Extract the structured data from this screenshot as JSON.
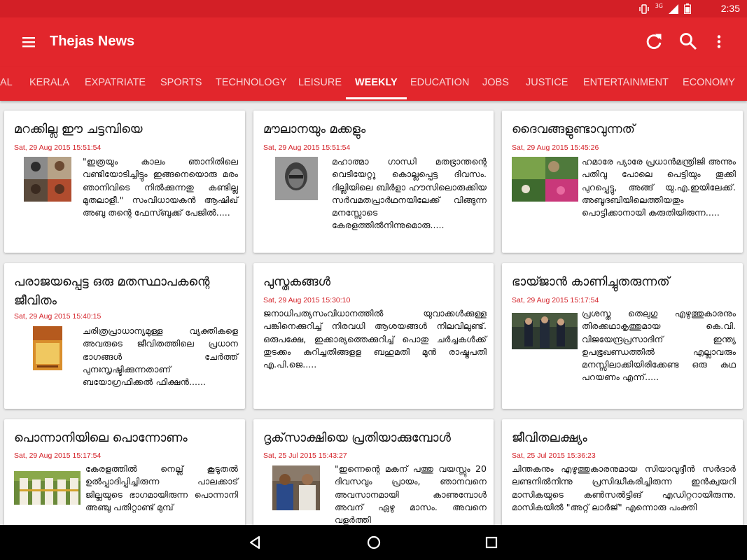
{
  "status_bar": {
    "network": "3G",
    "time": "2:35"
  },
  "app_bar": {
    "title": "Thejas News"
  },
  "tabs": [
    {
      "label": "AL"
    },
    {
      "label": "KERALA"
    },
    {
      "label": "EXPATRIATE"
    },
    {
      "label": "SPORTS"
    },
    {
      "label": "TECHNOLOGY"
    },
    {
      "label": "LEISURE"
    },
    {
      "label": "WEEKLY",
      "active": true
    },
    {
      "label": "EDUCATION"
    },
    {
      "label": "JOBS"
    },
    {
      "label": "JUSTICE"
    },
    {
      "label": "ENTERTAINMENT"
    },
    {
      "label": "ECONOMY"
    }
  ],
  "cards": [
    {
      "title": "മറക്കില്ല ഈ ചട്ടമ്പിയെ",
      "date": "Sat, 29 Aug 2015 15:51:54",
      "excerpt": "\"ഇത്രയും കാലം ഞാനിതിലെ വണ്ടിയോടിച്ചിട്ടും ഇങ്ങനെയൊരു മരം ഞാനിവിടെ നില്‍ക്കുന്നതു കണ്ടില്ല മുതലാളീ.\" സംവിധായകന്‍ ആഷിഖ് അബു തന്റെ ഫേസ്ബുക്ക് പേജില്‍....."
    },
    {
      "title": "മൗലാനയും മക്കളും",
      "date": "Sat, 29 Aug 2015 15:51:54",
      "excerpt": "മഹാത്മാ ഗാന്ധി മതഭ്രാന്തന്റെ വെടിയേറ്റു കൊല്ലപ്പെട്ട ദിവസം. ദില്ലിയിലെ ബിര്‍ളാ ഹൗസിലൊരുക്കിയ സര്‍വമതപ്രാര്‍ഥനയിലേക്ക് വിങ്ങുന്ന മനസ്സോടെ കേരളത്തില്‍നിന്നുമൊരു....."
    },
    {
      "title": "ദൈവങ്ങളുണ്ടാവുന്നത്",
      "date": "Sat, 29 Aug 2015 15:45:26",
      "excerpt": "ഹമാരേ പ്യാരേ പ്രധാന്‍മന്ത്രിജി അന്നും പതിവു പോലെ പെട്ടിയും തൂക്കി പുറപ്പെട്ടു, അങ്ങ് യു.എ.ഇയിലേക്ക്. അബൂദബിയിലെത്തിയതും പൊട്ടിക്കാനായി കരുതിയിരുന്ന....."
    },
    {
      "title": "പരാജയപ്പെട്ട ഒരു മതസ്ഥാപകന്റെ ജീവിതം",
      "date": "Sat, 29 Aug 2015 15:40:15",
      "excerpt": "ചരിത്രപ്രാധാന്യമുള്ള വ്യക്തികളെ അവരുടെ ജീവിതത്തിലെ പ്രധാന ഭാഗങ്ങള്‍ ചേര്‍ത്ത് പുനഃസൃഷ്ടിക്കുന്നതാണ് ബയോഗ്രഫിക്കല്‍ ഫിക്ഷന്‍......"
    },
    {
      "title": "പുസ്തകങ്ങള്‍",
      "date": "Sat, 29 Aug 2015 15:30:10",
      "excerpt": "ജനാധിപത്യസംവിധാനത്തില്‍ യുവാക്കള്‍ക്കുള്ള പങ്കിനെക്കുറിച്ച് നിരവധി ആശയങ്ങള്‍ നിലവിലുണ്ട്. ഒരുപക്ഷേ, ഇക്കാര്യത്തെക്കുറിച്ച് പൊതു ചര്‍ച്ചകള്‍ക്ക് തുടക്കം കുറിച്ചതിങ്ങളള ബഹുമതി മുന്‍ രാഷ്ട്രപതി എ.പി.ജെ....."
    },
    {
      "title": "ഭായ്ജാന്‍ കാണിച്ചുതരുന്നത്",
      "date": "Sat, 29 Aug 2015 15:17:54",
      "excerpt": "പ്രശസ്ത തെലുഗു എഴുത്തുകാരനും തിരക്കഥാകൃത്തുമായ കെ.വി. വിജയേന്ദ്രപ്രസാദിന് ഇന്ത്യ ഉപഭൂഖണ്ഡത്തില്‍ എല്ലാവരും മനസ്സിലാക്കിയിരിക്കേണ്ട ഒരു കഥ പറയണം എന്ന്....."
    },
    {
      "title": "പൊന്നാനിയിലെ പൊന്നോണം",
      "date": "Sat, 29 Aug 2015 15:17:54",
      "excerpt": "കേരളത്തില്‍ നെല്ല് കൂടുതല്‍ ഉല്‍പ്പാദിപ്പിച്ചിരുന്ന പാലക്കാട് ജില്ലയുടെ ഭാഗമായിരുന്ന പൊന്നാനി അഞ്ചു പതിറ്റാണ്ട് മുമ്പ്"
    },
    {
      "title": "ദൃക്‌സാക്ഷിയെ പ്രതിയാക്കുമ്പോള്‍",
      "date": "Sat, 25 Jul 2015 15:43:27",
      "excerpt": "\"ഇന്നെന്റെ മകന് പത്തു വയസ്സും 20 ദിവസവും പ്രായം, ഞാനവനെ അവസാനമായി കാണുമ്പോള്‍ അവന് ഏഴു മാസം. അവനെ വളര്‍ത്തി"
    },
    {
      "title": "ജീവിതലക്ഷ്യം",
      "date": "Sat, 25 Jul 2015 15:36:23",
      "excerpt": "ചിന്തകനും എഴുത്തുകാരനുമായ സിയാവുദ്ദീന്‍ സര്‍ദാര്‍ ലണ്ടനില്‍നിന്നു പ്രസിദ്ധീകരിച്ചിരുന്ന ഇന്‍ക്വയറി മാസികയുടെ കണ്‍സല്‍ട്ടിങ് എഡിറ്ററായിരുന്നു. മാസികയില്‍ \"അറ്റ് ലാര്‍ജ്\" എന്നൊരു പംക്തി"
    }
  ]
}
